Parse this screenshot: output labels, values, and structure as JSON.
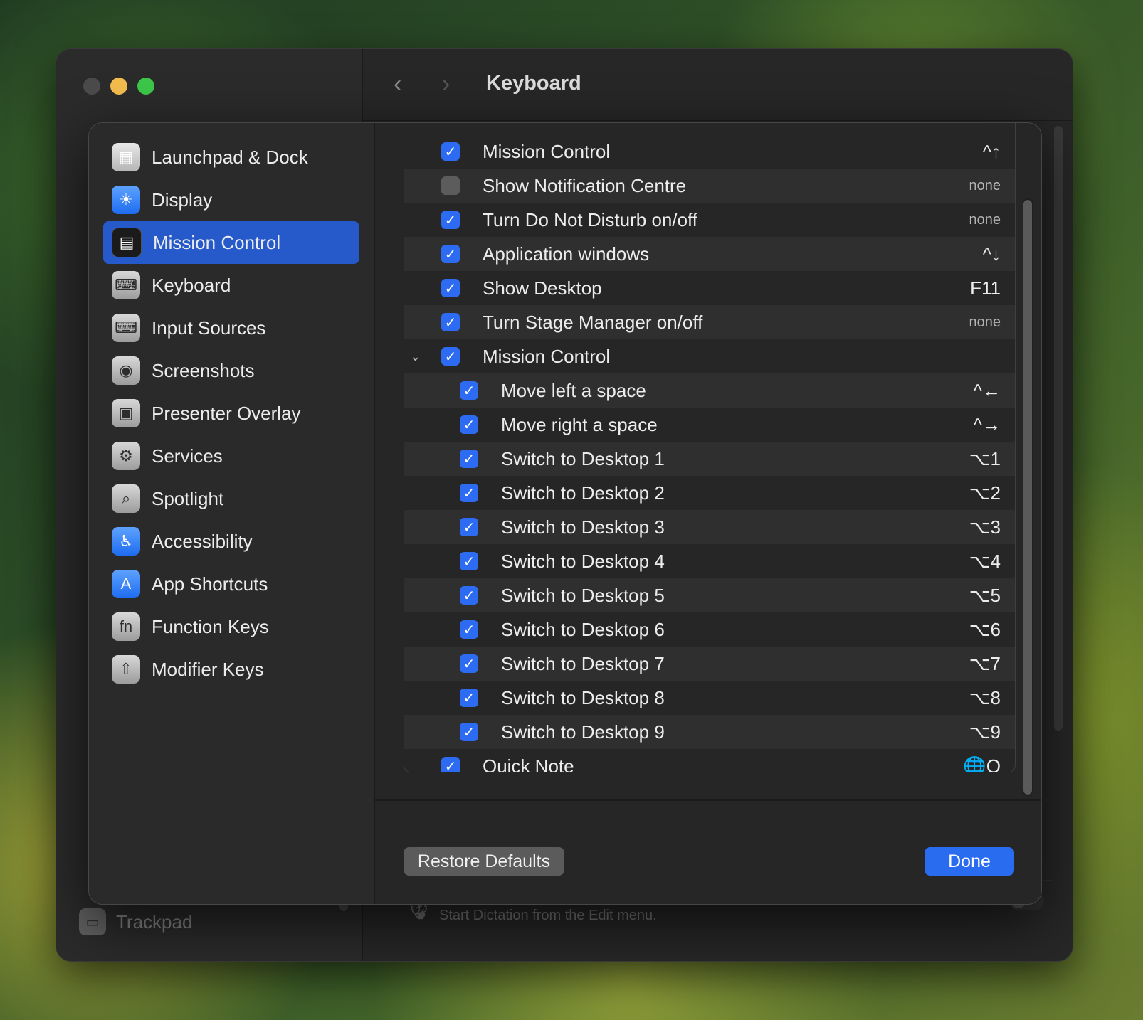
{
  "window": {
    "title": "Keyboard",
    "nav_back": "‹",
    "nav_forward": "›",
    "background_sidebar_item": "Trackpad",
    "dictation_text": "Use Dictation wherever you can type text. To start dictating, use the shortcut or select Start Dictation from the Edit menu."
  },
  "sidebar": {
    "items": [
      {
        "label": "Launchpad & Dock",
        "icon": "launchpad-icon",
        "glyph": "▦"
      },
      {
        "label": "Display",
        "icon": "display-icon",
        "glyph": "☀"
      },
      {
        "label": "Mission Control",
        "icon": "mission-control-icon",
        "glyph": "▤",
        "active": true
      },
      {
        "label": "Keyboard",
        "icon": "keyboard-icon",
        "glyph": "⌨"
      },
      {
        "label": "Input Sources",
        "icon": "input-sources-icon",
        "glyph": "⌨"
      },
      {
        "label": "Screenshots",
        "icon": "screenshots-icon",
        "glyph": "◉"
      },
      {
        "label": "Presenter Overlay",
        "icon": "presenter-overlay-icon",
        "glyph": "▣"
      },
      {
        "label": "Services",
        "icon": "services-icon",
        "glyph": "⚙"
      },
      {
        "label": "Spotlight",
        "icon": "spotlight-icon",
        "glyph": "⌕"
      },
      {
        "label": "Accessibility",
        "icon": "accessibility-icon",
        "glyph": "♿"
      },
      {
        "label": "App Shortcuts",
        "icon": "app-shortcuts-icon",
        "glyph": "A"
      },
      {
        "label": "Function Keys",
        "icon": "function-keys-icon",
        "glyph": "fn"
      },
      {
        "label": "Modifier Keys",
        "icon": "modifier-keys-icon",
        "glyph": "⇧"
      }
    ]
  },
  "shortcuts": [
    {
      "label": "Mission Control",
      "key": "^↑",
      "checked": true,
      "indent": 0
    },
    {
      "label": "Show Notification Centre",
      "key": "none",
      "checked": false,
      "indent": 0
    },
    {
      "label": "Turn Do Not Disturb on/off",
      "key": "none",
      "checked": true,
      "indent": 0
    },
    {
      "label": "Application windows",
      "key": "^↓",
      "checked": true,
      "indent": 0
    },
    {
      "label": "Show Desktop",
      "key": "F11",
      "checked": true,
      "indent": 0
    },
    {
      "label": "Turn Stage Manager on/off",
      "key": "none",
      "checked": true,
      "indent": 0
    },
    {
      "label": "Mission Control",
      "key": "",
      "checked": true,
      "indent": 0,
      "expanded": true
    },
    {
      "label": "Move left a space",
      "key": "^←",
      "checked": true,
      "indent": 1
    },
    {
      "label": "Move right a space",
      "key": "^→",
      "checked": true,
      "indent": 1
    },
    {
      "label": "Switch to Desktop 1",
      "key": "⌥1",
      "checked": true,
      "indent": 1
    },
    {
      "label": "Switch to Desktop 2",
      "key": "⌥2",
      "checked": true,
      "indent": 1
    },
    {
      "label": "Switch to Desktop 3",
      "key": "⌥3",
      "checked": true,
      "indent": 1
    },
    {
      "label": "Switch to Desktop 4",
      "key": "⌥4",
      "checked": true,
      "indent": 1
    },
    {
      "label": "Switch to Desktop 5",
      "key": "⌥5",
      "checked": true,
      "indent": 1
    },
    {
      "label": "Switch to Desktop 6",
      "key": "⌥6",
      "checked": true,
      "indent": 1
    },
    {
      "label": "Switch to Desktop 7",
      "key": "⌥7",
      "checked": true,
      "indent": 1
    },
    {
      "label": "Switch to Desktop 8",
      "key": "⌥8",
      "checked": true,
      "indent": 1
    },
    {
      "label": "Switch to Desktop 9",
      "key": "⌥9",
      "checked": true,
      "indent": 1
    },
    {
      "label": "Quick Note",
      "key": "🌐Q",
      "checked": true,
      "indent": 0
    }
  ],
  "footer": {
    "restore_label": "Restore Defaults",
    "done_label": "Done"
  },
  "colors": {
    "accent": "#2a6cf0",
    "selection": "#2659c9"
  }
}
